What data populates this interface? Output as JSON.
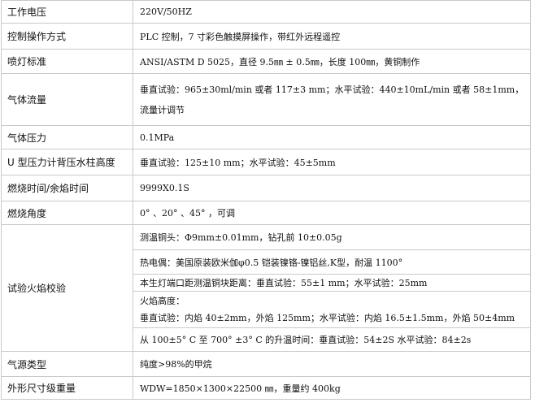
{
  "rows": [
    {
      "label": "工作电压",
      "value": "220V/50HZ"
    },
    {
      "label": "控制操作方式",
      "value": "PLC 控制，7 寸彩色触摸屏操作，带红外远程遥控"
    },
    {
      "label": "喷灯标准",
      "value": "ANSI/ASTM D 5025，直径 9.5㎜ ± 0.5㎜，长度 100㎜，黄铜制作"
    },
    {
      "label": "气体流量",
      "line1": "垂直试验：965±30ml/min 或者 117±3 mm；水平试验：440±10mL/min 或者 58±1mm，",
      "line2": "流量计调节"
    },
    {
      "label": "气体压力",
      "value": "0.1MPa"
    },
    {
      "label": "U 型压力计背压水柱高度",
      "value": "垂直试验：125±10 mm；水平试验：45±5mm"
    },
    {
      "label": "燃烧时间/余焰时间",
      "value": "9999X0.1S"
    },
    {
      "label": "燃烧角度",
      "value": "0° 、20° 、45° ，可调"
    },
    {
      "label": "试验火焰校验",
      "subs": [
        "测温铜头：Φ9mm±0.01mm，钻孔前 10±0.05g",
        "热电偶：美国原装欧米伽φ0.5 铠装镍铬-镍铝丝,K型，耐温 1100°",
        "本生灯端口距测温铜块距离：垂直试验：55±1 mm；水平试验：25mm",
        "火焰高度：",
        "垂直试验：内焰 40±2mm，外焰 125mm；水平试验：内焰 16.5±1.5mm，外焰 50±4mm",
        "从 100±5° C 至 700° ±3° C 的升温时间：垂直试验：54±2S 水平试验：84±2s"
      ]
    },
    {
      "label": "气源类型",
      "value": "纯度>98%的甲烷"
    },
    {
      "label": "外形尺寸级重量",
      "value": "WDW=1850×1300×22500 ㎜，重量约 400kg"
    }
  ]
}
